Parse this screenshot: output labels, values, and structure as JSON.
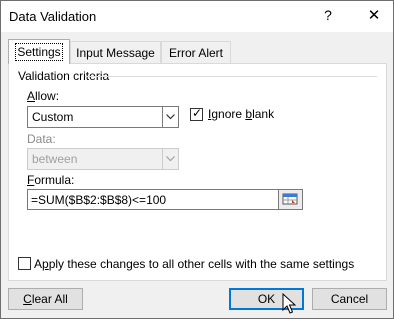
{
  "window": {
    "title": "Data Validation",
    "help_glyph": "?",
    "close_glyph": "✕"
  },
  "tabs": [
    {
      "label": "Settings",
      "active": true
    },
    {
      "label": "Input Message",
      "active": false
    },
    {
      "label": "Error Alert",
      "active": false
    }
  ],
  "settings": {
    "group_title": "Validation criteria",
    "allow_label": "Allow:",
    "allow_value": "Custom",
    "ignore_blank_label": "Ignore blank",
    "ignore_blank_checked": true,
    "data_label": "Data:",
    "data_value": "between",
    "formula_label": "Formula:",
    "formula_value": "=SUM($B$2:$B$8)<=100",
    "apply_label": "Apply these changes to all other cells with the same settings",
    "apply_checked": false
  },
  "buttons": {
    "clear_all": "Clear All",
    "ok": "OK",
    "cancel": "Cancel"
  },
  "icons": {
    "dropdown": "chevron-down-icon",
    "range_picker": "collapse-dialog-icon",
    "cursor": "mouse-pointer-icon"
  },
  "colors": {
    "default_button_border": "#0078d7",
    "panel_bg": "#ffffff",
    "dialog_bg": "#f0f0f0"
  }
}
